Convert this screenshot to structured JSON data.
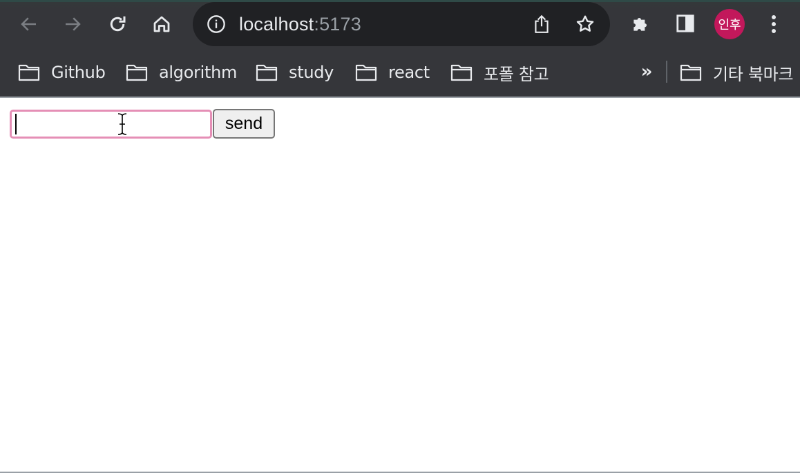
{
  "browser": {
    "url_host": "localhost",
    "url_port": ":5173",
    "profile_initials": "인후",
    "nav_buttons": [
      "back-icon",
      "forward-icon",
      "reload-icon",
      "home-icon"
    ],
    "omnibox_icons": [
      "info-icon",
      "share-icon",
      "star-icon"
    ],
    "toolbar_icons": [
      "extensions-icon",
      "side-panel-icon",
      "kebab-menu-icon"
    ],
    "bookmarks": [
      {
        "label": "Github",
        "icon": "folder-icon"
      },
      {
        "label": "algorithm",
        "icon": "folder-icon"
      },
      {
        "label": "study",
        "icon": "folder-icon"
      },
      {
        "label": "react",
        "icon": "folder-icon"
      },
      {
        "label": "포폴 참고",
        "icon": "folder-icon"
      }
    ],
    "bookmarks_overflow": "»",
    "other_bookmarks": {
      "label": "기타 북마크",
      "icon": "folder-icon"
    }
  },
  "page": {
    "message_input_value": "",
    "send_label": "send"
  },
  "colors": {
    "toolbar_bg": "#35363a",
    "omnibox_bg": "#202124",
    "avatar_bg": "#c2185b",
    "input_focus_border": "#e58fb6"
  }
}
